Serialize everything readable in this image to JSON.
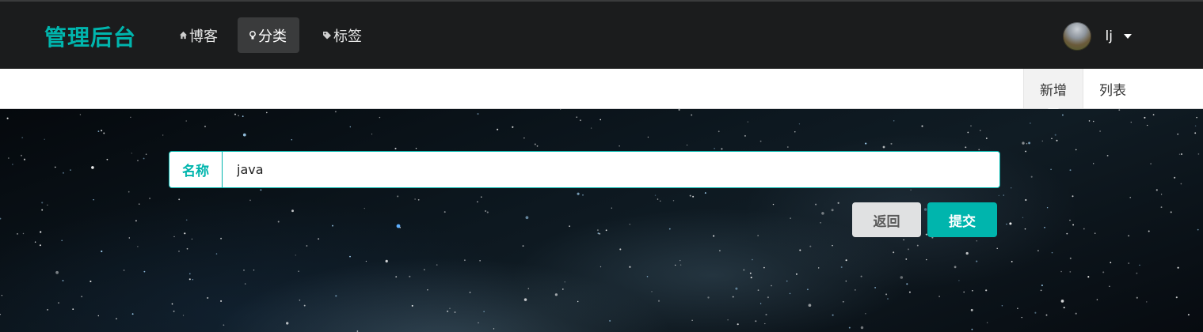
{
  "header": {
    "brand": "管理后台",
    "nav": [
      {
        "label": "博客",
        "icon": "home-icon"
      },
      {
        "label": "分类",
        "icon": "idea-icon",
        "active": true
      },
      {
        "label": "标签",
        "icon": "tags-icon"
      }
    ],
    "user": {
      "name": "lj",
      "icon": "caret-down-icon"
    }
  },
  "subnav": {
    "tabs": [
      {
        "label": "新增",
        "active": true
      },
      {
        "label": "列表"
      }
    ]
  },
  "form": {
    "name_label": "名称",
    "name_value": "java",
    "back_label": "返回",
    "submit_label": "提交"
  },
  "colors": {
    "accent": "#00b5ad",
    "topbar": "#1b1c1d",
    "nav_active": "#3a3b3c"
  }
}
